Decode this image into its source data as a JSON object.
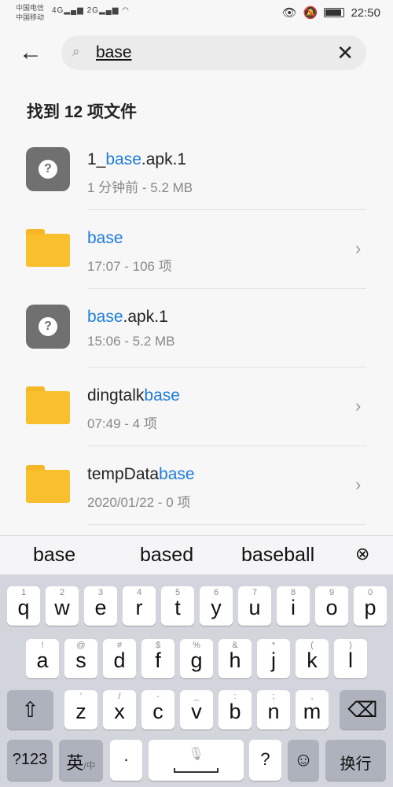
{
  "status": {
    "carrier1": "中国电信",
    "carrier2": "中国移动",
    "signal1": "4G",
    "signal2": "2G",
    "time": "22:50",
    "battery_level": 0.9
  },
  "search": {
    "query": "base",
    "back": "←",
    "clear": "✕",
    "search_icon": "⌕"
  },
  "found_label": "找到 12 项文件",
  "files": [
    {
      "type": "unknown",
      "pre": "1_",
      "match": "base",
      "post": ".apk.1",
      "meta": "1 分钟前 - 5.2 MB",
      "chevron": false
    },
    {
      "type": "folder",
      "pre": "",
      "match": "base",
      "post": "",
      "meta": "17:07 - 106 项",
      "chevron": true
    },
    {
      "type": "unknown",
      "pre": "",
      "match": "base",
      "post": ".apk.1",
      "meta": "15:06 - 5.2 MB",
      "chevron": false
    },
    {
      "type": "folder",
      "pre": "dingtalk",
      "match": "base",
      "post": "",
      "meta": "07:49 - 4 项",
      "chevron": true
    },
    {
      "type": "folder",
      "pre": "tempData",
      "match": "base",
      "post": "",
      "meta": "2020/01/22 - 0 项",
      "chevron": true
    }
  ],
  "suggestions": [
    "base",
    "based",
    "baseball"
  ],
  "suggestion_close": "⊗",
  "keyboard": {
    "row1": [
      [
        "q",
        "1"
      ],
      [
        "w",
        "2"
      ],
      [
        "e",
        "3"
      ],
      [
        "r",
        "4"
      ],
      [
        "t",
        "5"
      ],
      [
        "y",
        "6"
      ],
      [
        "u",
        "7"
      ],
      [
        "i",
        "8"
      ],
      [
        "o",
        "9"
      ],
      [
        "p",
        "0"
      ]
    ],
    "row2": [
      [
        "a",
        "!"
      ],
      [
        "s",
        "@"
      ],
      [
        "d",
        "#"
      ],
      [
        "f",
        "$"
      ],
      [
        "g",
        "%"
      ],
      [
        "h",
        "&"
      ],
      [
        "j",
        "*"
      ],
      [
        "k",
        "("
      ],
      [
        "l",
        ")"
      ]
    ],
    "row3": [
      [
        "z",
        "'"
      ],
      [
        "x",
        "/"
      ],
      [
        "c",
        "-"
      ],
      [
        "v",
        "_"
      ],
      [
        "b",
        ":"
      ],
      [
        "n",
        ";"
      ],
      [
        "m",
        ","
      ]
    ],
    "shift": "⇧",
    "delete": "⌫",
    "num": "?123",
    "lang": "英",
    "lang_alt": "/中",
    "dot": "·",
    "space": "␣",
    "question": "?",
    "emoji": "☺",
    "enter": "换行"
  }
}
